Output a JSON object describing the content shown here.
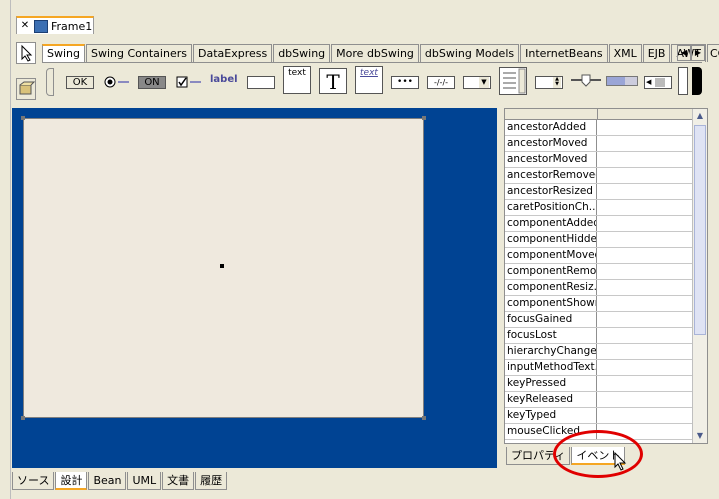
{
  "window": {
    "title": "Frame1"
  },
  "palette": {
    "tabs": [
      "Swing",
      "Swing Containers",
      "DataExpress",
      "dbSwing",
      "More dbSwing",
      "dbSwing Models",
      "InternetBeans",
      "XML",
      "EJB",
      "AWT",
      "CO"
    ],
    "active_tab": "Swing",
    "components": {
      "ok_label": "OK",
      "on_label": "ON",
      "label_text": "label",
      "text_area": "text",
      "big_t": "T",
      "text_pane": "text",
      "password_dots": "•••",
      "formatted_text": "-/-/-"
    }
  },
  "inspector": {
    "events": [
      "ancestorAdded",
      "ancestorMoved",
      "ancestorMoved",
      "ancestorRemoved",
      "ancestorResized",
      "caretPositionCh...",
      "componentAdded",
      "componentHidden",
      "componentMoved",
      "componentRemo...",
      "componentResiz...",
      "componentShown",
      "focusGained",
      "focusLost",
      "hierarchyChanged",
      "inputMethodText...",
      "keyPressed",
      "keyReleased",
      "keyTyped",
      "mouseClicked"
    ],
    "tabs": [
      "プロパティ",
      "イベント"
    ],
    "active_tab": "イベント"
  },
  "bottom_tabs": [
    "ソース",
    "設計",
    "Bean",
    "UML",
    "文書",
    "履歴"
  ],
  "bottom_active": "設計",
  "colors": {
    "design_bg": "#004393",
    "highlight": "#e00000",
    "tab_accent": "#f5a623"
  }
}
